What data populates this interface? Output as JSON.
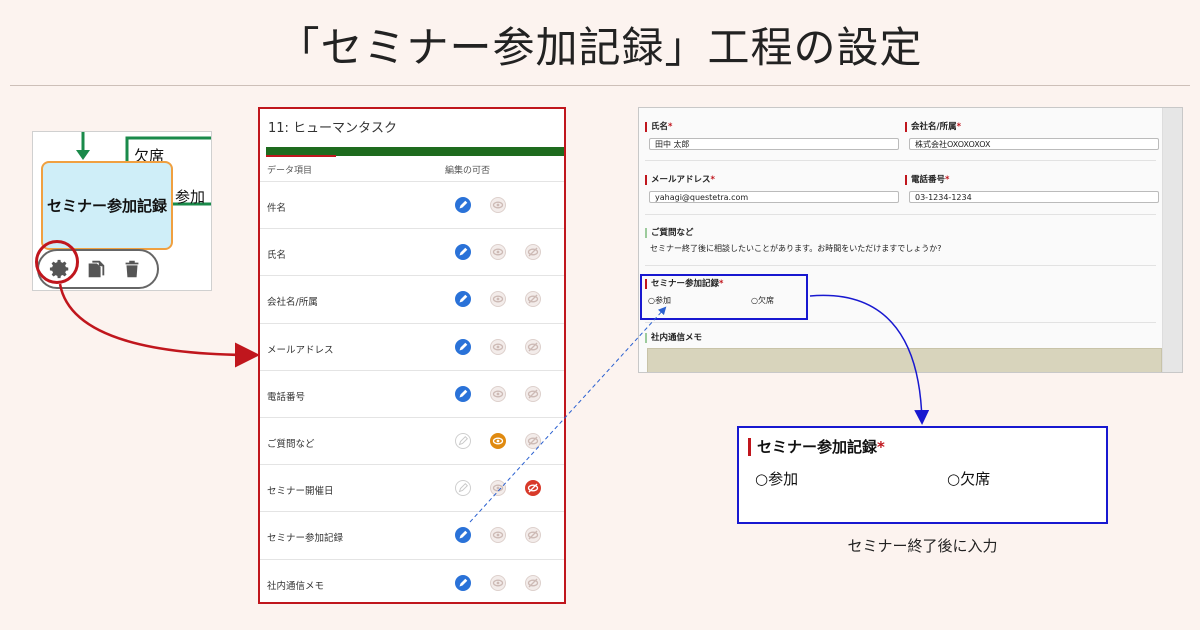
{
  "title": "「セミナー参加記録」工程の設定",
  "node": {
    "label": "セミナー参加記録",
    "branch_absent": "欠席",
    "branch_attend": "参加"
  },
  "permissions": {
    "header": "11: ヒューマンタスク",
    "col_item": "データ項目",
    "col_editable": "編集の可否",
    "rows": [
      {
        "label": "件名",
        "state": "editable"
      },
      {
        "label": "氏名",
        "state": "editable"
      },
      {
        "label": "会社名/所属",
        "state": "editable"
      },
      {
        "label": "メールアドレス",
        "state": "editable"
      },
      {
        "label": "電話番号",
        "state": "editable"
      },
      {
        "label": "ご質問など",
        "state": "display"
      },
      {
        "label": "セミナー開催日",
        "state": "hidden"
      },
      {
        "label": "セミナー参加記録",
        "state": "editable"
      },
      {
        "label": "社内通信メモ",
        "state": "editable"
      }
    ]
  },
  "form": {
    "name_label": "氏名",
    "name_value": "田中 太郎",
    "company_label": "会社名/所属",
    "company_value": "株式会社OXOXOXOX",
    "email_label": "メールアドレス",
    "email_value": "yahagi@questetra.com",
    "phone_label": "電話番号",
    "phone_value": "03-1234-1234",
    "question_label": "ご質問など",
    "question_value": "セミナー終了後に相談したいことがあります。お時間をいただけますでしょうか?",
    "seminar_label": "セミナー参加記録",
    "opt_attend": "○参加",
    "opt_absent": "○欠席",
    "memo_label": "社内通信メモ",
    "required_mark": "*"
  },
  "zoom": {
    "label": "セミナー参加記録",
    "required_mark": "*",
    "opt_attend": "○参加",
    "opt_absent": "○欠席",
    "caption": "セミナー終了後に入力"
  },
  "colors": {
    "background": "#fcf3ef",
    "accent_red": "#c0161d",
    "accent_blue": "#1818d0",
    "edit_blue": "#2a72d8",
    "display_orange": "#e08a10",
    "hidden_red": "#d83a2a"
  }
}
